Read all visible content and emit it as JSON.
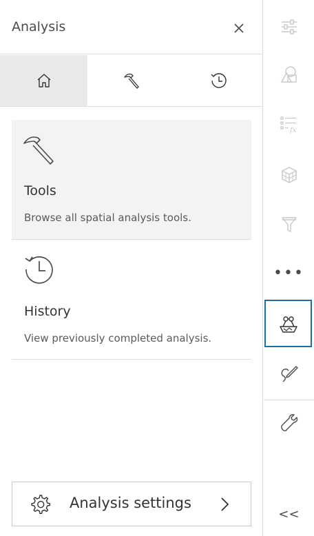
{
  "panel": {
    "title": "Analysis",
    "close_icon": "close-icon",
    "tabs": [
      {
        "name": "home",
        "icon": "home-icon"
      },
      {
        "name": "tools",
        "icon": "hammer-icon"
      },
      {
        "name": "history",
        "icon": "history-icon"
      }
    ],
    "cards": [
      {
        "title": "Tools",
        "description": "Browse all spatial analysis tools.",
        "icon": "hammer-icon"
      },
      {
        "title": "History",
        "description": "View previously completed analysis.",
        "icon": "history-icon"
      }
    ],
    "settings_label": "Analysis settings",
    "settings_icon": "gear-icon",
    "settings_chevron": "chevron-right-icon"
  },
  "rail": {
    "items": [
      {
        "icon": "sliders-icon",
        "state": "disabled"
      },
      {
        "icon": "shapes-icon",
        "state": "disabled"
      },
      {
        "icon": "list-formula-icon",
        "state": "disabled"
      },
      {
        "icon": "cube-icon",
        "state": "disabled"
      },
      {
        "icon": "filter-icon",
        "state": "disabled"
      },
      {
        "icon": "more-icon",
        "state": "enabled"
      },
      {
        "icon": "analysis-icon",
        "state": "active"
      },
      {
        "icon": "sketch-icon",
        "state": "enabled"
      },
      {
        "icon": "wrench-icon",
        "state": "enabled"
      }
    ],
    "more_label": "•••",
    "collapse_label": "<<"
  },
  "colors": {
    "accent": "#1b6fa8",
    "selected_tab_bg": "#eaeaea",
    "card_bg": "#f3f3f3",
    "disabled_icon": "#c8c8c8",
    "icon": "#4a4a4a"
  }
}
